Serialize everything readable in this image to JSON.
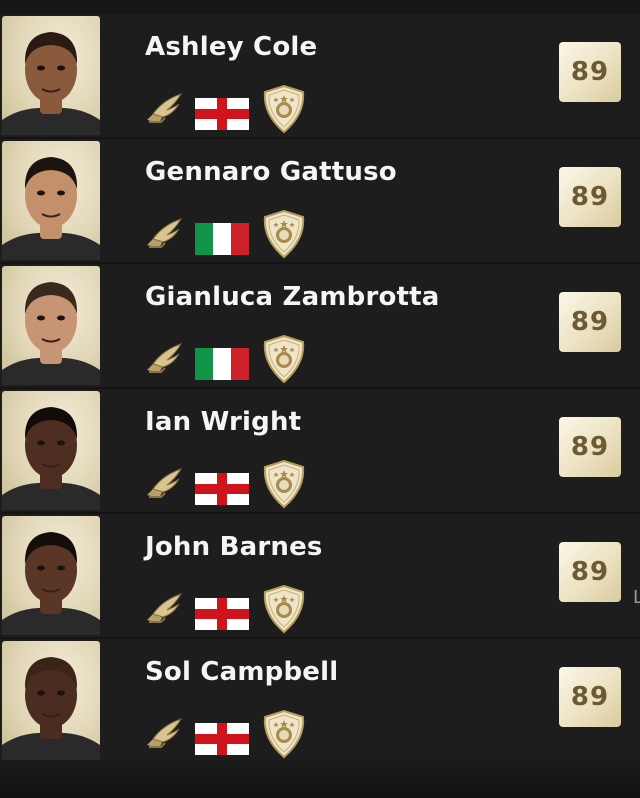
{
  "players": [
    {
      "name": "Ashley Cole",
      "rating": "89",
      "nation": "england",
      "skin": "#8a5a3c",
      "hair": "#2a1a12"
    },
    {
      "name": "Gennaro Gattuso",
      "rating": "89",
      "nation": "italy",
      "skin": "#c48f6b",
      "hair": "#1b1410"
    },
    {
      "name": "Gianluca Zambrotta",
      "rating": "89",
      "nation": "italy",
      "skin": "#c79474",
      "hair": "#3a2a1e"
    },
    {
      "name": "Ian Wright",
      "rating": "89",
      "nation": "england",
      "skin": "#4e2e20",
      "hair": "#120c09"
    },
    {
      "name": "John Barnes",
      "rating": "89",
      "nation": "england",
      "skin": "#5a3626",
      "hair": "#140d0a"
    },
    {
      "name": "Sol Campbell",
      "rating": "89",
      "nation": "england",
      "skin": "#4a2c20",
      "hair": "#3b2418"
    }
  ],
  "icons": {
    "position": "winged-boot-icon",
    "badge": "icon-crest-icon"
  },
  "colors": {
    "row_bg": "#1d1d1d",
    "rating_text": "#6b5a32",
    "gold": "#c9b27a",
    "england_red": "#d0141c",
    "italy_green": "#119447",
    "italy_red": "#cd212a"
  }
}
